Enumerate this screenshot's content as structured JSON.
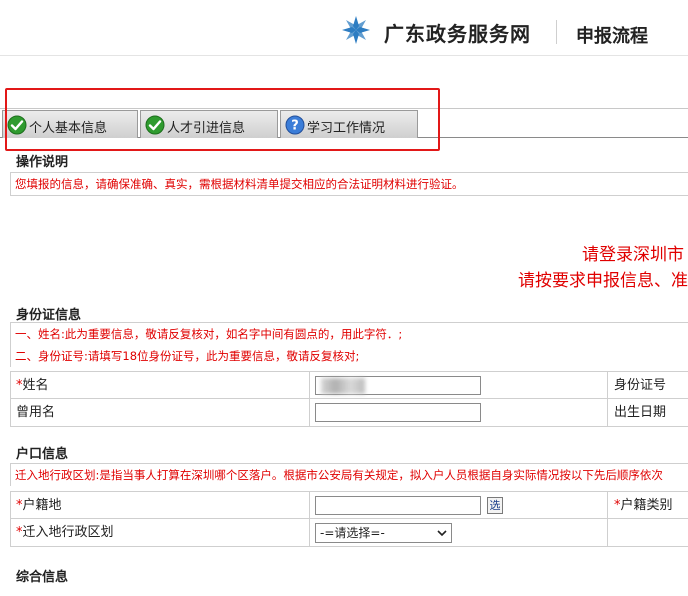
{
  "header": {
    "site_title": "广东政务服务网",
    "page_title": "申报流程"
  },
  "tabs": [
    {
      "label": "个人基本信息",
      "icon": "check-circle-icon"
    },
    {
      "label": "人才引进信息",
      "icon": "check-circle-icon"
    },
    {
      "label": "学习工作情况",
      "icon": "question-circle-icon"
    }
  ],
  "instructions": {
    "title": "操作说明",
    "text": "您填报的信息，请确保准确、真实，需根据材料清单提交相应的合法证明材料进行验证。"
  },
  "banner": {
    "line1": "请登录深圳市",
    "line2": "请按要求申报信息、准"
  },
  "id_section": {
    "title": "身份证信息",
    "notes": [
      "一、姓名:此为重要信息，敬请反复核对，如名字中间有圆点的，用此字符．;",
      "二、身份证号:请填写18位身份证号，此为重要信息，敬请反复核对;"
    ],
    "name_label": "姓名",
    "id_number_label": "身份证号",
    "former_name_label": "曾用名",
    "birth_date_label": "出生日期"
  },
  "hukou_section": {
    "title": "户口信息",
    "note": "迁入地行政区划:是指当事人打算在深圳哪个区落户。根据市公安局有关规定，拟入户人员根据自身实际情况按以下先后顺序依次",
    "origin_label": "户籍地",
    "select_button": "选",
    "hukou_type_label": "户籍类别",
    "district_label": "迁入地行政区划",
    "district_value": "-=请选择=-"
  },
  "next_section": {
    "title": "综合信息"
  },
  "colors": {
    "required": "#e00000",
    "highlight_box": "#e21818",
    "logo": "#2e7dc2"
  }
}
